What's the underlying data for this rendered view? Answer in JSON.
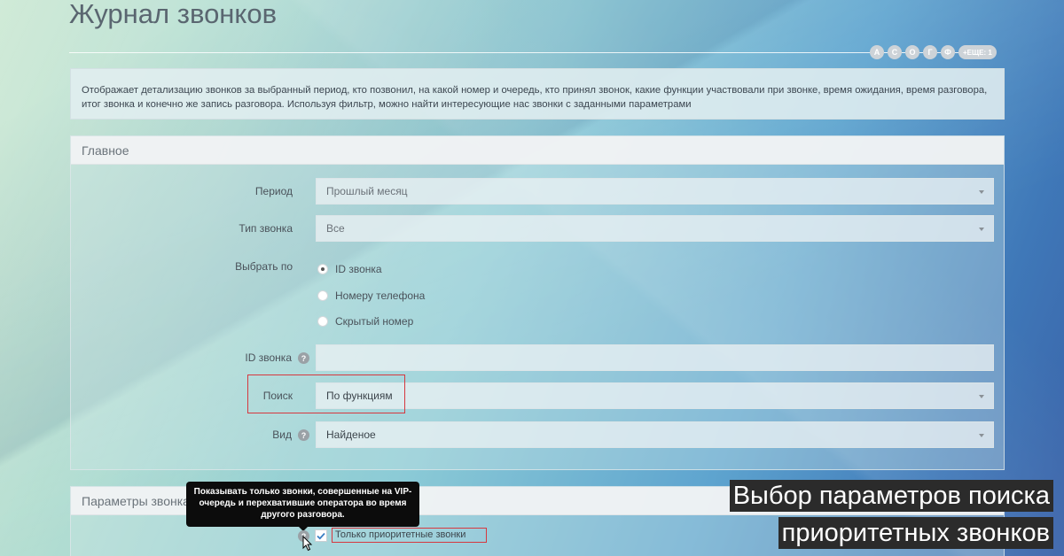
{
  "page": {
    "title": "Журнал звонков",
    "alphabet": [
      "А",
      "С",
      "О",
      "Г",
      "Ф"
    ],
    "alphabet_more": "+ЕЩЕ: 1",
    "description": "Отображает детализацию звонков за выбранный период, кто позвонил, на какой номер и очередь, кто принял звонок, какие функции участвовали при звонке, время ожидания, время разговора, итог звонка и конечно же запись разговора. Используя фильтр, можно найти интересующие нас звонки с заданными параметрами"
  },
  "main_panel": {
    "title": "Главное",
    "period_label": "Период",
    "period_value": "Прошлый месяц",
    "call_type_label": "Тип звонка",
    "call_type_value": "Все",
    "select_by_label": "Выбрать по",
    "select_by_options": [
      "ID звонка",
      "Номеру телефона",
      "Скрытый номер"
    ],
    "select_by_selected": "ID звонка",
    "call_id_label": "ID звонка",
    "call_id_value": "",
    "search_label": "Поиск",
    "search_value": "По функциям",
    "view_label": "Вид",
    "view_value": "Найденое"
  },
  "params_panel": {
    "title": "Параметры звонка",
    "tooltip": "Показывать только звонки, совершенные на VIP-очередь и перехватившие оператора во время другого разговора.",
    "priority_checkbox_label": "Только приоритетные звонки",
    "priority_checked": true
  },
  "caption": {
    "line1": "Выбор параметров поиска",
    "line2": "приоритетных звонков"
  },
  "colors": {
    "highlight": "#d6383f",
    "caption_bg": "#2b2b2b"
  }
}
